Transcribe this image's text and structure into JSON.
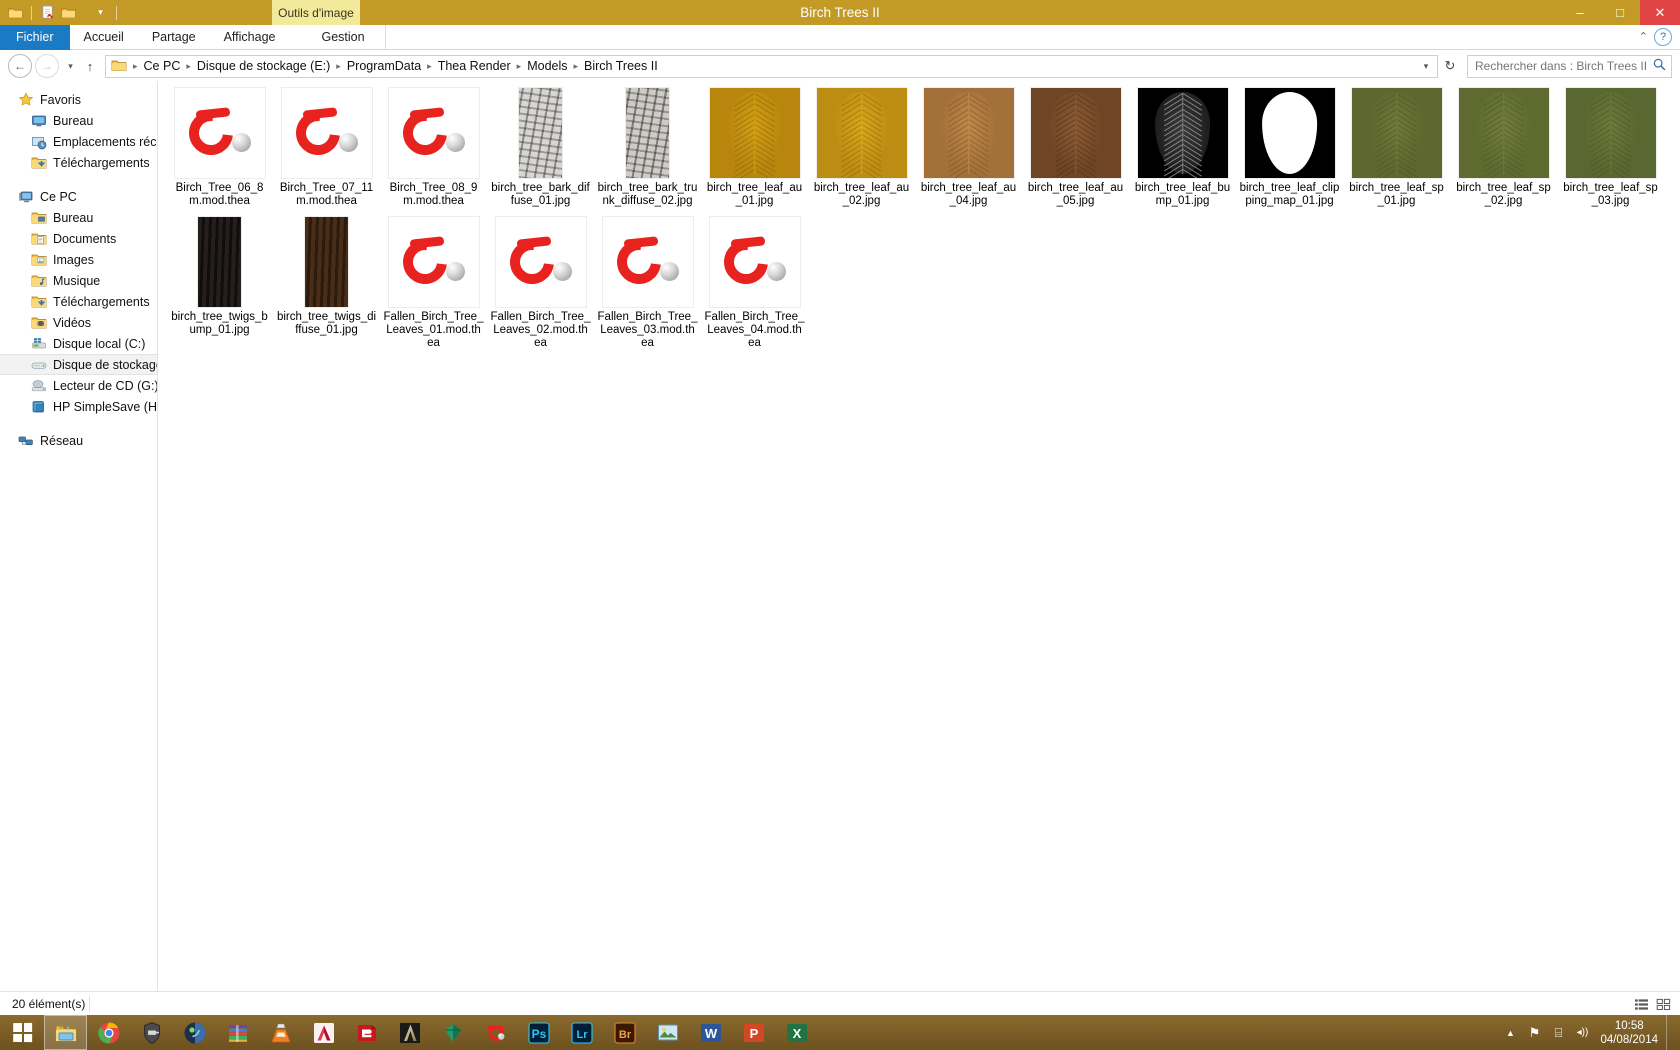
{
  "window": {
    "title": "Birch Trees II",
    "contextual_tab": "Outils d'image",
    "minimize": "–",
    "maximize": "□",
    "close": "✕",
    "help": "?",
    "ribbon_chevron": "⌃"
  },
  "quick_access": {
    "items": [
      "folder-icon",
      "properties-icon",
      "new-folder-icon",
      "customize-chevron-icon"
    ]
  },
  "ribbon": {
    "tabs": [
      {
        "label": "Fichier",
        "active": true,
        "file": true
      },
      {
        "label": "Accueil",
        "active": false,
        "file": false
      },
      {
        "label": "Partage",
        "active": false,
        "file": false
      },
      {
        "label": "Affichage",
        "active": false,
        "file": false
      },
      {
        "label": "Gestion",
        "active": false,
        "file": false
      }
    ]
  },
  "nav": {
    "back": "←",
    "forward": "→",
    "recent_dropdown": "▾",
    "up": "↑",
    "crumb_dropdown": "▾",
    "refresh": "↻",
    "separator": "▸"
  },
  "breadcrumb": {
    "items": [
      "Ce PC",
      "Disque de stockage (E:)",
      "ProgramData",
      "Thea Render",
      "Models",
      "Birch Trees II"
    ]
  },
  "search": {
    "placeholder": "Rechercher dans : Birch Trees II",
    "value": "",
    "icon": "search-icon"
  },
  "sidebar": {
    "groups": [
      {
        "header": {
          "label": "Favoris",
          "icon": "star-icon",
          "color": "#f2b01e"
        },
        "items": [
          {
            "label": "Bureau",
            "icon": "desktop-icon"
          },
          {
            "label": "Emplacements récents",
            "icon": "recent-places-icon"
          },
          {
            "label": "Téléchargements",
            "icon": "downloads-icon"
          }
        ]
      },
      {
        "header": {
          "label": "Ce PC",
          "icon": "computer-icon",
          "color": "#4a7fb5"
        },
        "items": [
          {
            "label": "Bureau",
            "icon": "desktop-folder-icon"
          },
          {
            "label": "Documents",
            "icon": "documents-icon"
          },
          {
            "label": "Images",
            "icon": "pictures-icon"
          },
          {
            "label": "Musique",
            "icon": "music-icon"
          },
          {
            "label": "Téléchargements",
            "icon": "downloads-icon"
          },
          {
            "label": "Vidéos",
            "icon": "videos-icon"
          },
          {
            "label": "Disque local (C:)",
            "icon": "system-drive-icon"
          },
          {
            "label": "Disque de stockage",
            "icon": "drive-icon",
            "selected": true
          },
          {
            "label": "Lecteur de CD (G:) H",
            "icon": "cd-drive-icon"
          },
          {
            "label": "HP SimpleSave (H:)",
            "icon": "external-drive-icon"
          }
        ]
      },
      {
        "header": {
          "label": "Réseau",
          "icon": "network-icon",
          "color": "#4a7fb5"
        },
        "items": []
      }
    ]
  },
  "files": [
    {
      "name": "Birch_Tree_06_8m.mod.thea",
      "kind": "thea",
      "row": 1
    },
    {
      "name": "Birch_Tree_07_11m.mod.thea",
      "kind": "thea",
      "row": 1
    },
    {
      "name": "Birch_Tree_08_9m.mod.thea",
      "kind": "thea",
      "row": 1
    },
    {
      "name": "birch_tree_bark_diffuse_01.jpg",
      "kind": "bark",
      "row": 1,
      "colors": [
        "#d8d6d2",
        "#8e8c88"
      ]
    },
    {
      "name": "birch_tree_bark_trunk_diffuse_02.jpg",
      "kind": "bark",
      "row": 1,
      "colors": [
        "#cfccc7",
        "#7f7d79"
      ]
    },
    {
      "name": "birch_tree_leaf_au_01.jpg",
      "kind": "leaf",
      "row": 1,
      "colors": [
        "#d2a016",
        "#b8860d",
        "#8c6508"
      ]
    },
    {
      "name": "birch_tree_leaf_au_02.jpg",
      "kind": "leaf",
      "row": 1,
      "colors": [
        "#d8a81c",
        "#bd8c12",
        "#90660a"
      ]
    },
    {
      "name": "birch_tree_leaf_au_04.jpg",
      "kind": "leaf",
      "row": 1,
      "colors": [
        "#c08a4a",
        "#a3703a",
        "#7d5128"
      ]
    },
    {
      "name": "birch_tree_leaf_au_05.jpg",
      "kind": "leaf",
      "row": 1,
      "colors": [
        "#8d5c34",
        "#6f4526",
        "#4e2f18"
      ]
    },
    {
      "name": "birch_tree_leaf_bump_01.jpg",
      "kind": "bump",
      "row": 1,
      "colors": [
        "#000000",
        "#7d7d7d"
      ]
    },
    {
      "name": "birch_tree_leaf_clipping_map_01.jpg",
      "kind": "clip",
      "row": 1,
      "colors": [
        "#000000",
        "#ffffff"
      ]
    },
    {
      "name": "birch_tree_leaf_sp_01.jpg",
      "kind": "leaf",
      "row": 1,
      "colors": [
        "#6f7a3a",
        "#5d672f",
        "#4a5326"
      ]
    },
    {
      "name": "birch_tree_leaf_sp_02.jpg",
      "kind": "leaf",
      "row": 1,
      "colors": [
        "#727d3d",
        "#5f6a31",
        "#4c5527"
      ]
    },
    {
      "name": "birch_tree_leaf_sp_03.jpg",
      "kind": "leaf",
      "row": 1,
      "colors": [
        "#6d7a3c",
        "#5a6730",
        "#495326"
      ]
    },
    {
      "name": "birch_tree_twigs_bump_01.jpg",
      "kind": "twig",
      "row": 2,
      "colors": [
        "#241f1c",
        "#100d0b"
      ]
    },
    {
      "name": "birch_tree_twigs_diffuse_01.jpg",
      "kind": "twig",
      "row": 2,
      "colors": [
        "#4a2d18",
        "#2c1a0d"
      ]
    },
    {
      "name": "Fallen_Birch_Tree_Leaves_01.mod.thea",
      "kind": "thea",
      "row": 2
    },
    {
      "name": "Fallen_Birch_Tree_Leaves_02.mod.thea",
      "kind": "thea",
      "row": 2
    },
    {
      "name": "Fallen_Birch_Tree_Leaves_03.mod.thea",
      "kind": "thea",
      "row": 2
    },
    {
      "name": "Fallen_Birch_Tree_Leaves_04.mod.thea",
      "kind": "thea",
      "row": 2
    }
  ],
  "status": {
    "count_text": "20 élément(s)",
    "view_details": "details-view-icon",
    "view_large": "large-icons-view-icon"
  },
  "taskbar": {
    "start": "start-button",
    "pinned": [
      {
        "name": "file-explorer-icon",
        "active": true
      },
      {
        "name": "google-chrome-icon",
        "active": false
      },
      {
        "name": "world-of-tanks-icon",
        "active": false
      },
      {
        "name": "media-player-icon",
        "active": false
      },
      {
        "name": "winrar-icon",
        "active": false
      },
      {
        "name": "vlc-icon",
        "active": false
      },
      {
        "name": "autocad-icon",
        "active": false
      },
      {
        "name": "sketchup-icon",
        "active": false
      },
      {
        "name": "artlantis-icon",
        "active": false
      },
      {
        "name": "gem-icon",
        "active": false
      },
      {
        "name": "thea-render-icon",
        "active": false
      },
      {
        "name": "photoshop-icon",
        "active": false
      },
      {
        "name": "lightroom-icon",
        "active": false
      },
      {
        "name": "bridge-icon",
        "active": false
      },
      {
        "name": "picture-viewer-icon",
        "active": false
      },
      {
        "name": "word-icon",
        "active": false
      },
      {
        "name": "powerpoint-icon",
        "active": false
      },
      {
        "name": "excel-icon",
        "active": false
      }
    ],
    "tray": {
      "show_hidden": "▲",
      "network": "⚑",
      "display": "⌸",
      "volume": "◂))",
      "time": "10:58",
      "date": "04/08/2014"
    }
  },
  "theme": {
    "titlebar": "#c49a27",
    "file_tab": "#1a7bc4",
    "contextual_tab": "#f3e99a",
    "close_button": "#e04343",
    "taskbar": "#7a5c26"
  }
}
